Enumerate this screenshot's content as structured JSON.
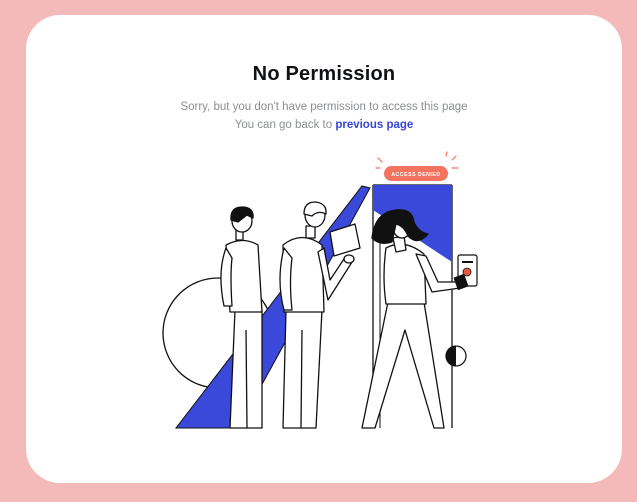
{
  "page": {
    "title": "No Permission",
    "message_line1": "Sorry, but you don't have permission to access this page",
    "message_line2_prefix": "You can go back to ",
    "back_link_label": "previous page"
  },
  "illustration": {
    "badge_label": "ACCESS DENIED"
  },
  "colors": {
    "background": "#f4b9b9",
    "card": "#ffffff",
    "link": "#3646d8",
    "accent_blue": "#3a49da",
    "badge": "#f4735f",
    "button_red": "#e8573f"
  }
}
